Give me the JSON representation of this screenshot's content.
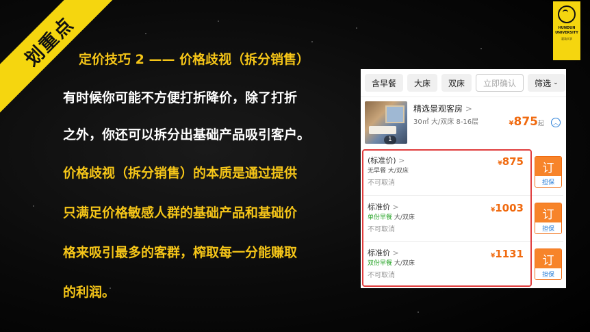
{
  "ribbon": {
    "text": "划重点"
  },
  "logo": {
    "line1": "HUNDUN",
    "line2": "UNIVERSITY",
    "line3": "混沌大学"
  },
  "title": "定价技巧 2 —— 价格歧视（拆分销售）",
  "paragraph1": [
    "有时候你可能不方便打折降价，除了打折",
    "之外，你还可以拆分出基础产品吸引客户。"
  ],
  "paragraph2": [
    "价格歧视（拆分销售）的本质是通过提供",
    "只满足价格敏感人群的基础产品和基础价",
    "格来吸引最多的客群，榨取每一分能赚取",
    "的利润。"
  ],
  "hotel": {
    "filters": [
      "含早餐",
      "大床",
      "双床",
      "立即确认",
      "筛选"
    ],
    "room": {
      "name": "精选景观客房",
      "chevron": ">",
      "spec": "30㎡ 大/双床 8-16层",
      "photo_count": "1",
      "price_symbol": "¥",
      "price": "875",
      "price_suffix": "起"
    },
    "rates": [
      {
        "name": "(标准价)",
        "chevron": ">",
        "meal": "无早餐",
        "bed": "大/双床",
        "cancel": "不可取消",
        "price_symbol": "¥",
        "price": "875",
        "book": "订",
        "guarantee": "担保"
      },
      {
        "name": "标准价",
        "chevron": ">",
        "meal": "单份早餐",
        "bed": "大/双床",
        "cancel": "不可取消",
        "price_symbol": "¥",
        "price": "1003",
        "book": "订",
        "guarantee": "担保"
      },
      {
        "name": "标准价",
        "chevron": ">",
        "meal": "双份早餐",
        "bed": "大/双床",
        "cancel": "不可取消",
        "price_symbol": "¥",
        "price": "1131",
        "book": "订",
        "guarantee": "担保"
      }
    ]
  },
  "colors": {
    "accent_yellow": "#f5c518",
    "ribbon_yellow": "#f5d60f",
    "price_orange": "#f06a0f",
    "highlight_red": "#e03c3c",
    "link_blue": "#2a7fd8",
    "green": "#2aa52a"
  }
}
